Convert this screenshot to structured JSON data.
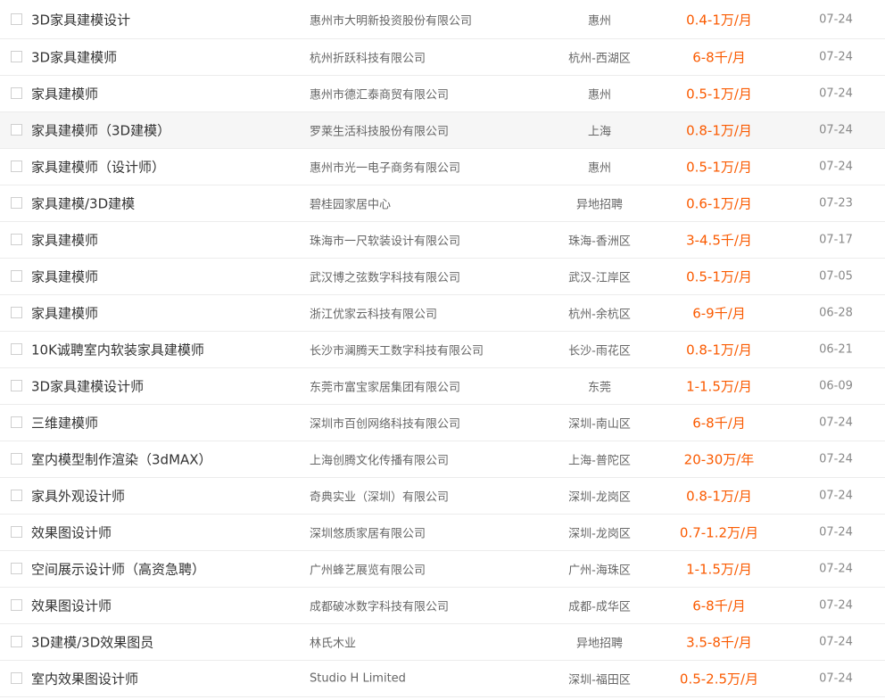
{
  "jobs": [
    {
      "title": "3D家具建模设计",
      "company": "惠州市大明新投资股份有限公司",
      "location": "惠州",
      "salary": "0.4-1万/月",
      "date": "07-24"
    },
    {
      "title": "3D家具建模师",
      "company": "杭州折跃科技有限公司",
      "location": "杭州-西湖区",
      "salary": "6-8千/月",
      "date": "07-24"
    },
    {
      "title": "家具建模师",
      "company": "惠州市德汇泰商贸有限公司",
      "location": "惠州",
      "salary": "0.5-1万/月",
      "date": "07-24"
    },
    {
      "title": "家具建模师（3D建模）",
      "company": "罗莱生活科技股份有限公司",
      "location": "上海",
      "salary": "0.8-1万/月",
      "date": "07-24",
      "highlighted": true
    },
    {
      "title": "家具建模师（设计师）",
      "company": "惠州市光一电子商务有限公司",
      "location": "惠州",
      "salary": "0.5-1万/月",
      "date": "07-24"
    },
    {
      "title": "家具建模/3D建模",
      "company": "碧桂园家居中心",
      "location": "异地招聘",
      "salary": "0.6-1万/月",
      "date": "07-23"
    },
    {
      "title": "家具建模师",
      "company": "珠海市一尺软装设计有限公司",
      "location": "珠海-香洲区",
      "salary": "3-4.5千/月",
      "date": "07-17"
    },
    {
      "title": "家具建模师",
      "company": "武汉博之弦数字科技有限公司",
      "location": "武汉-江岸区",
      "salary": "0.5-1万/月",
      "date": "07-05"
    },
    {
      "title": "家具建模师",
      "company": "浙江优家云科技有限公司",
      "location": "杭州-余杭区",
      "salary": "6-9千/月",
      "date": "06-28"
    },
    {
      "title": "10K诚聘室内软装家具建模师",
      "company": "长沙市澜腾天工数字科技有限公司",
      "location": "长沙-雨花区",
      "salary": "0.8-1万/月",
      "date": "06-21"
    },
    {
      "title": "3D家具建模设计师",
      "company": "东莞市富宝家居集团有限公司",
      "location": "东莞",
      "salary": "1-1.5万/月",
      "date": "06-09"
    },
    {
      "title": "三维建模师",
      "company": "深圳市百创网络科技有限公司",
      "location": "深圳-南山区",
      "salary": "6-8千/月",
      "date": "07-24"
    },
    {
      "title": "室内模型制作渲染（3dMAX）",
      "company": "上海创腾文化传播有限公司",
      "location": "上海-普陀区",
      "salary": "20-30万/年",
      "date": "07-24"
    },
    {
      "title": "家具外观设计师",
      "company": "奇典实业（深圳）有限公司",
      "location": "深圳-龙岗区",
      "salary": "0.8-1万/月",
      "date": "07-24"
    },
    {
      "title": "效果图设计师",
      "company": "深圳悠质家居有限公司",
      "location": "深圳-龙岗区",
      "salary": "0.7-1.2万/月",
      "date": "07-24"
    },
    {
      "title": "空间展示设计师（高资急聘）",
      "company": "广州蜂艺展览有限公司",
      "location": "广州-海珠区",
      "salary": "1-1.5万/月",
      "date": "07-24"
    },
    {
      "title": "效果图设计师",
      "company": "成都破冰数字科技有限公司",
      "location": "成都-成华区",
      "salary": "6-8千/月",
      "date": "07-24"
    },
    {
      "title": "3D建模/3D效果图员",
      "company": "林氏木业",
      "location": "异地招聘",
      "salary": "3.5-8千/月",
      "date": "07-24"
    },
    {
      "title": "室内效果图设计师",
      "company": "Studio H Limited",
      "location": "深圳-福田区",
      "salary": "0.5-2.5万/月",
      "date": "07-24"
    }
  ],
  "colors": {
    "salary": "#fa5a00",
    "title": "#333333",
    "muted": "#666666",
    "row_highlight": "#f6f6f6"
  }
}
